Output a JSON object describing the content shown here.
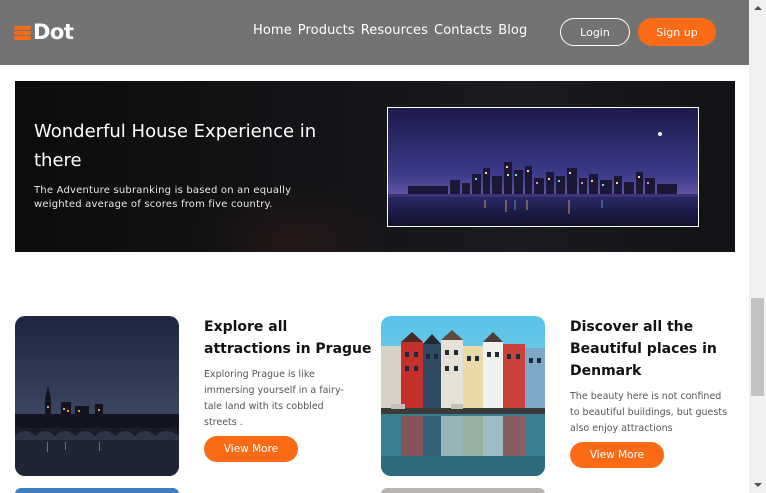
{
  "brand": {
    "name": "Dot",
    "accent": "#fb6b16"
  },
  "nav": {
    "items": [
      "Home",
      "Products",
      "Resources",
      "Contacts",
      "Blog"
    ],
    "login_label": "Login",
    "signup_label": "Sign up"
  },
  "hero": {
    "title": "Wonderful House Experience in there",
    "description": "The Adventure subranking is based on an equally weighted average of scores from five country."
  },
  "cards": [
    {
      "title": "Explore all attractions in Prague",
      "description": "Exploring Prague is like immersing yourself in a fairy-tale land with its cobbled streets .",
      "button_label": "View More"
    },
    {
      "title": "Discover all the Beautiful places in Denmark",
      "description": "The beauty here is not confined to beautiful buildings, but guests also enjoy attractions",
      "button_label": "View More"
    }
  ]
}
